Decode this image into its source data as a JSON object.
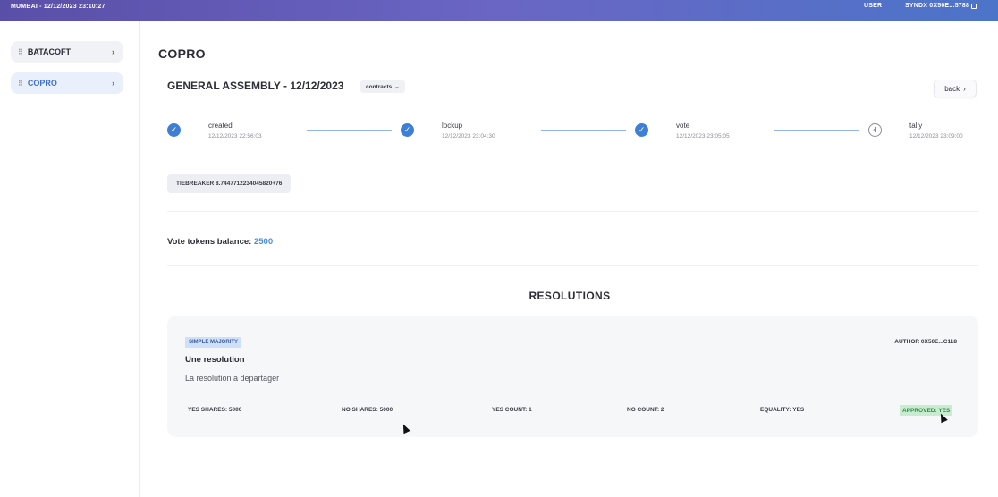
{
  "topbar": {
    "location_time": "MUMBAI - 12/12/2023 23:10:27",
    "user_label": "USER",
    "wallet": "SYNDX 0X50E...5788",
    "wallet_icon": "copy-icon",
    "gradient": [
      "#5a4fa8",
      "#4c74c9"
    ]
  },
  "sidebar": {
    "items": [
      {
        "label": "BATACOFT",
        "icon": "drag-handle-icon",
        "active": false
      },
      {
        "label": "COPRO",
        "icon": "drag-handle-icon",
        "active": true
      }
    ]
  },
  "page": {
    "title": "COPRO",
    "assembly_title": "GENERAL ASSEMBLY - 12/12/2023",
    "contracts_label": "contracts",
    "back_label": "back"
  },
  "steps": [
    {
      "label": "created",
      "date": "12/12/2023 22:56:03",
      "done": true
    },
    {
      "label": "lockup",
      "date": "12/12/2023 23:04:30",
      "done": true
    },
    {
      "label": "vote",
      "date": "12/12/2023 23:05:05",
      "done": true
    },
    {
      "label": "tally",
      "date": "12/12/2023 23:09:00",
      "done": false,
      "number": "4"
    }
  ],
  "tiebreaker": "TIEBREAKER 8.7447712234045820+76",
  "balance": {
    "label": "Vote tokens balance:",
    "value": "2500"
  },
  "resolutions": {
    "heading": "RESOLUTIONS",
    "items": [
      {
        "majority": "SIMPLE MAJORITY",
        "author": "AUTHOR 0X50E...C118",
        "title": "Une resolution",
        "description": "La resolution a departager",
        "yes_shares": "YES SHARES: 5000",
        "no_shares": "NO SHARES: 5000",
        "yes_count": "YES COUNT: 1",
        "no_count": "NO COUNT: 2",
        "equality": "EQUALITY: YES",
        "approved": "APPROVED: YES"
      }
    ]
  },
  "colors": {
    "accent": "#3d7ed6",
    "approved_bg": "#c9ecd0",
    "approved_text": "#2f8c48",
    "majority_bg": "#cfe0fa"
  }
}
